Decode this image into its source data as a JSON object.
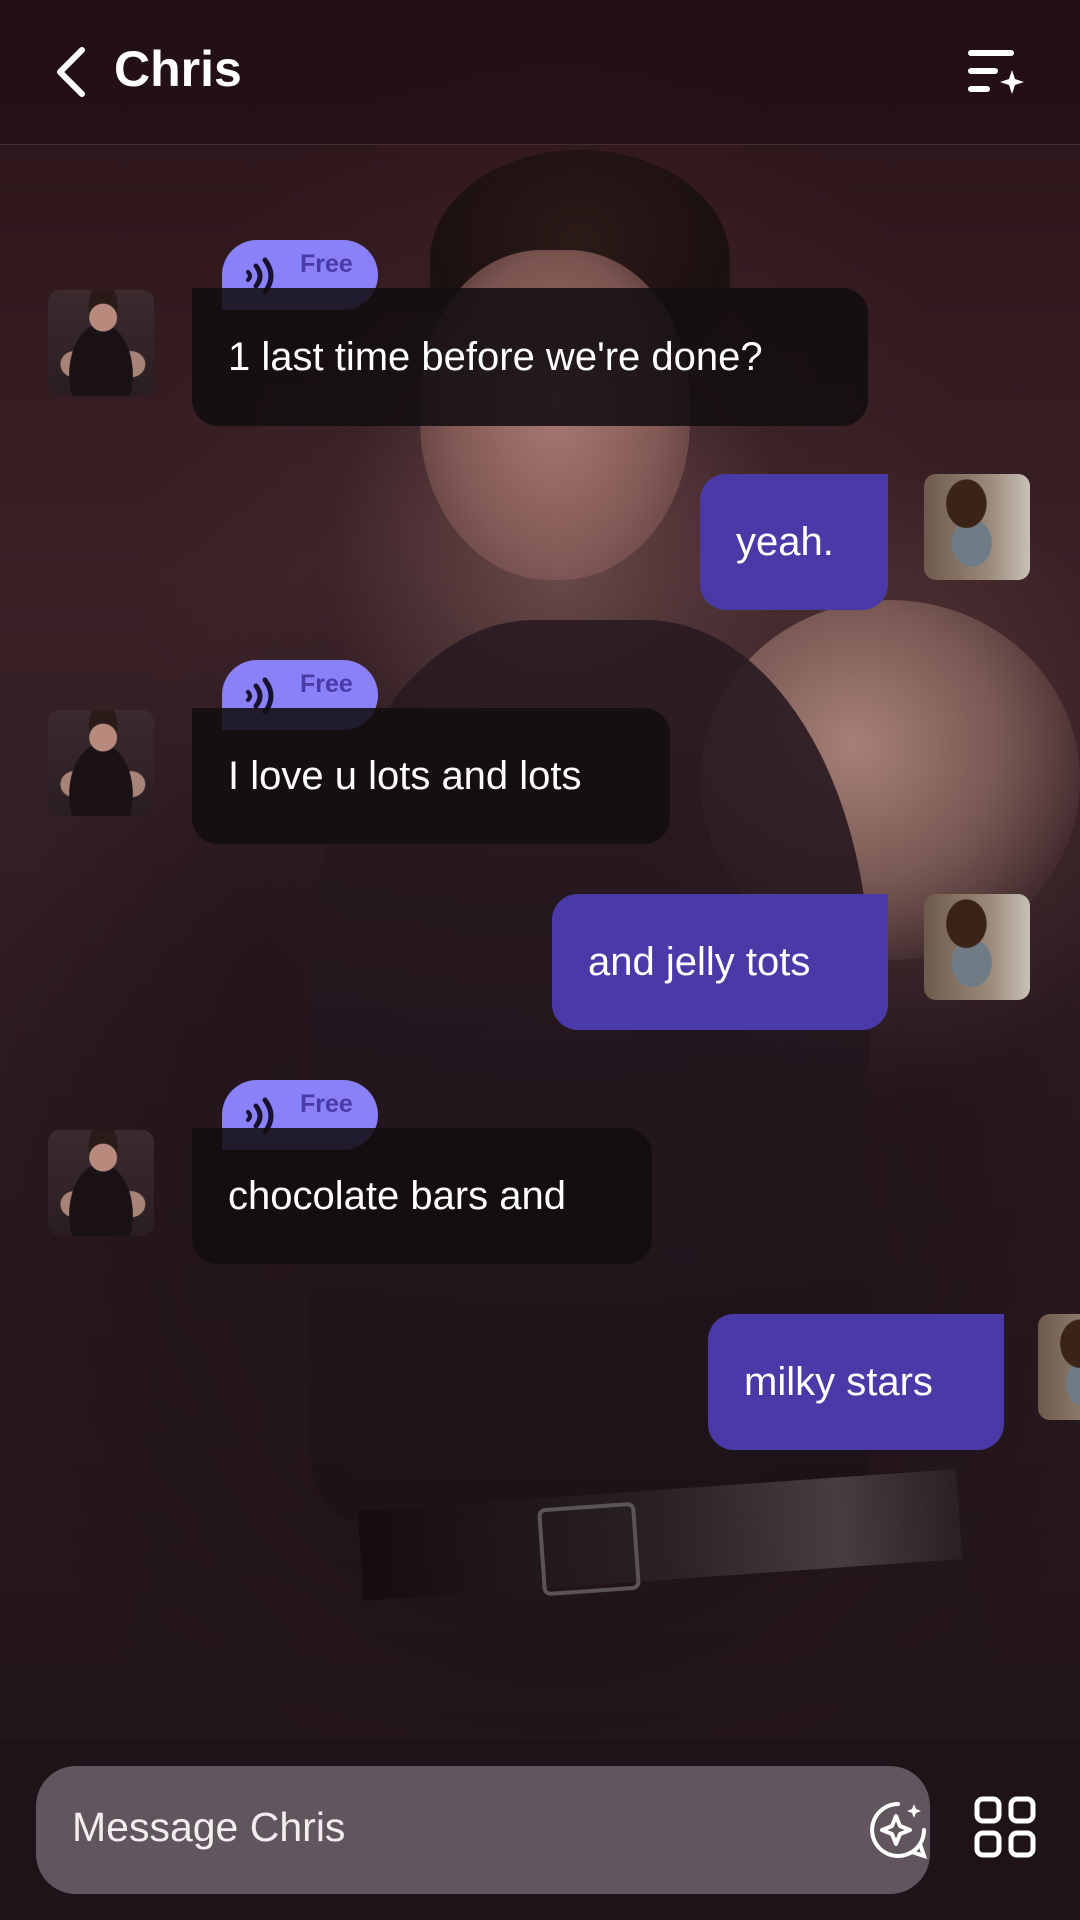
{
  "header": {
    "title": "Chris",
    "back_icon": "chevron-left-icon",
    "menu_icon": "list-sparkle-icon"
  },
  "messages": [
    {
      "sender": "Chris",
      "text": "1 last time before we're done?",
      "tag": "Free"
    },
    {
      "sender": "user",
      "text": "yeah."
    },
    {
      "sender": "Chris",
      "text": "I love u lots and lots",
      "tag": "Free"
    },
    {
      "sender": "user",
      "text": "and jelly tots"
    },
    {
      "sender": "Chris",
      "text": "chocolate bars and",
      "tag": "Free"
    },
    {
      "sender": "user",
      "text": "milky stars"
    }
  ],
  "composer": {
    "placeholder": "Message Chris",
    "sparkle_icon": "ai-sparkle-icon",
    "apps_icon": "grid-icon"
  },
  "colors": {
    "outgoing_bubble": "#4a3aa8",
    "incoming_bubble": "#120e10",
    "free_tag": "#8a80f8",
    "free_tag_text": "#4a3aa8"
  }
}
